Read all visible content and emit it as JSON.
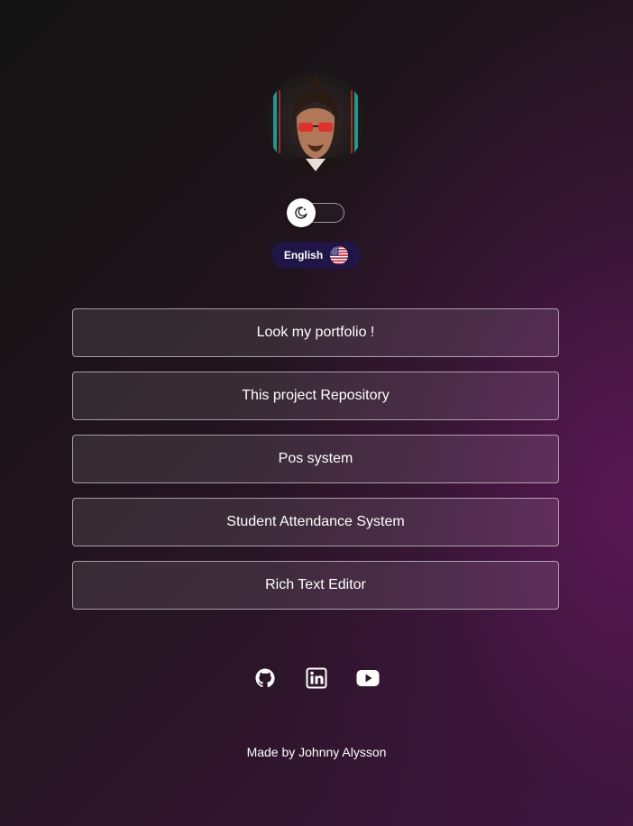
{
  "profile": {
    "avatar_icon": "avatar-portrait"
  },
  "theme_toggle": {
    "icon": "moon-icon",
    "state": "dark"
  },
  "language": {
    "label": "English",
    "flag_icon": "us-flag-icon"
  },
  "links": [
    {
      "label": "Look my portfolio !"
    },
    {
      "label": "This project Repository"
    },
    {
      "label": "Pos system"
    },
    {
      "label": "Student Attendance System"
    },
    {
      "label": "Rich Text Editor"
    }
  ],
  "social": [
    {
      "icon": "github-icon"
    },
    {
      "icon": "linkedin-icon"
    },
    {
      "icon": "youtube-icon"
    }
  ],
  "footer": {
    "text": "Made by Johnny Alysson"
  },
  "colors": {
    "background_dark": "#141414",
    "background_accent": "#5c1856",
    "language_pill": "#1f1546",
    "button_border": "#ffffff"
  }
}
